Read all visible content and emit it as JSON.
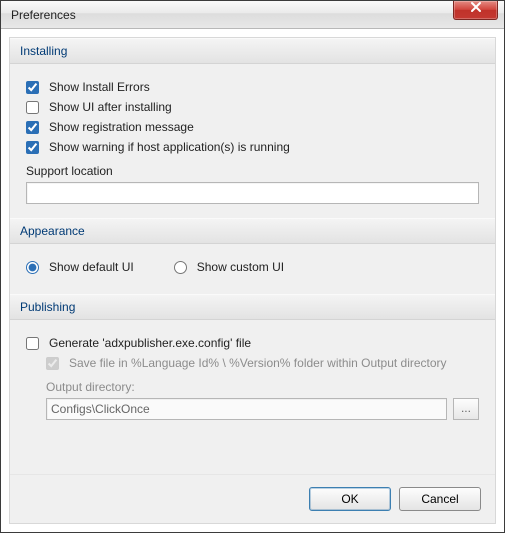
{
  "window": {
    "title": "Preferences"
  },
  "sections": {
    "installing": {
      "title": "Installing",
      "show_install_errors_label": "Show Install Errors",
      "show_install_errors_checked": true,
      "show_ui_after_label": "Show UI after installing",
      "show_ui_after_checked": false,
      "show_registration_label": "Show registration message",
      "show_registration_checked": true,
      "show_warning_host_label": "Show warning if host application(s) is running",
      "show_warning_host_checked": true,
      "support_location_label": "Support location",
      "support_location_value": ""
    },
    "appearance": {
      "title": "Appearance",
      "show_default_ui_label": "Show default UI",
      "show_custom_ui_label": "Show custom UI",
      "selected": "default"
    },
    "publishing": {
      "title": "Publishing",
      "generate_config_label": "Generate 'adxpublisher.exe.config' file",
      "generate_config_checked": false,
      "save_in_folder_label": "Save file in %Language Id% \\ %Version% folder within Output directory",
      "save_in_folder_checked": true,
      "save_in_folder_enabled": false,
      "output_directory_label": "Output directory:",
      "output_directory_value": "Configs\\ClickOnce",
      "output_directory_enabled": false,
      "browse_label": "..."
    }
  },
  "buttons": {
    "ok": "OK",
    "cancel": "Cancel"
  }
}
